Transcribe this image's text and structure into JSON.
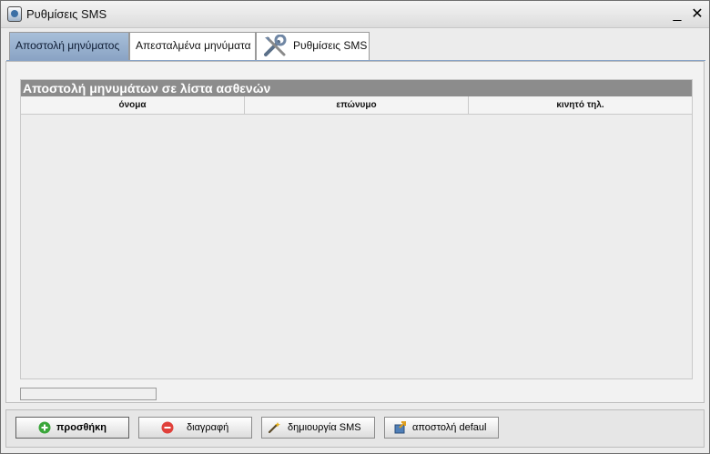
{
  "window": {
    "title": "Ρυθμίσεις SMS",
    "minimize_label": "_",
    "close_label": "✕"
  },
  "tabs": [
    {
      "label": "Αποστολή μηνύματος",
      "active": true
    },
    {
      "label": "Απεσταλμένα μηνύματα",
      "active": false
    },
    {
      "label": "Ρυθμίσεις SMS",
      "active": false,
      "icon": "tools-icon"
    }
  ],
  "grid": {
    "title": "Αποστολή μηνυμάτων σε λίστα ασθενών",
    "columns": [
      "όνομα",
      "επώνυμο",
      "κινητό τηλ."
    ],
    "rows": []
  },
  "progress": {
    "value": 0
  },
  "buttons": {
    "add": {
      "label": "προσθήκη",
      "icon": "plus-circle-icon",
      "color": "#3aa63a"
    },
    "delete": {
      "label": "διαγραφή",
      "icon": "minus-circle-icon",
      "color": "#e0403a"
    },
    "create_sms": {
      "label": "δημιουργία SMS",
      "icon": "magic-wand-icon"
    },
    "send_default": {
      "label": "αποστολή defaul",
      "icon": "send-icon"
    }
  },
  "colors": {
    "active_tab": "#8aa3c4",
    "grid_title_bg": "#8c8c8c"
  }
}
